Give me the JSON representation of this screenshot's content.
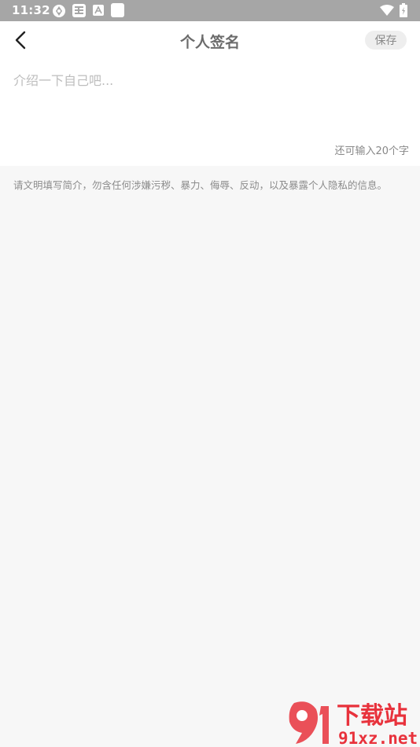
{
  "status_bar": {
    "time": "11:32",
    "icons": [
      "app-notification-icon",
      "news-icon",
      "font-icon",
      "square-icon",
      "wifi-icon",
      "battery-icon"
    ]
  },
  "header": {
    "title": "个人签名",
    "save_label": "保存",
    "back_icon": "chevron-left-icon"
  },
  "editor": {
    "placeholder": "介绍一下自己吧...",
    "value": "",
    "counter": "还可输入20个字"
  },
  "notice": "请文明填写简介，勿含任何涉嫌污秽、暴力、侮辱、反动，以及暴露个人隐私的信息。",
  "watermark": {
    "brand": "下载站",
    "url": "91xz.net"
  },
  "colors": {
    "status_bar_bg": "#a6a6a6",
    "page_bg": "#f7f7f7",
    "watermark_red": "#e8323c"
  }
}
